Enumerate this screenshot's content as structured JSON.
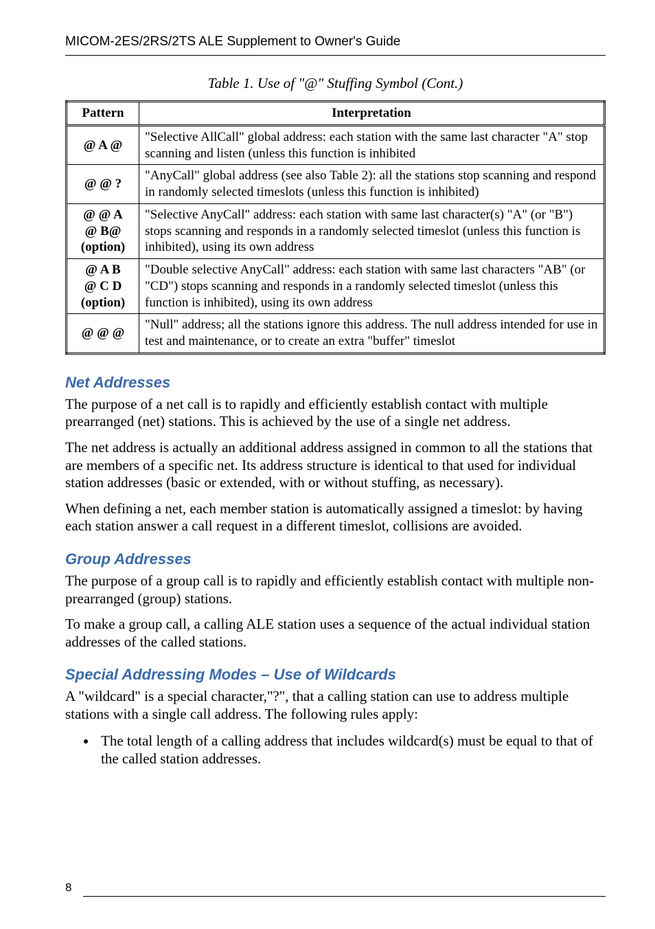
{
  "header": "MICOM-2ES/2RS/2TS ALE Supplement to Owner's Guide",
  "table_caption": "Table 1. Use of \"@\" Stuffing Symbol (Cont.)",
  "table": {
    "col1_header": "Pattern",
    "col2_header": "Interpretation",
    "rows": [
      {
        "pattern": "@ A @",
        "interp": "\"Selective AllCall\" global address: each station with the same last character \"A\" stop scanning and listen (unless this function is inhibited"
      },
      {
        "pattern": "@ @ ?",
        "interp": "\"AnyCall\" global address (see also Table 2): all the stations stop scanning and respond in randomly selected timeslots (unless this function is inhibited)"
      },
      {
        "pattern": "@ @ A\n@ B@\n(option)",
        "interp": "\"Selective AnyCall\" address: each station with same last character(s) \"A\" (or \"B\") stops scanning and responds in a randomly selected timeslot (unless this function is inhibited), using its own address"
      },
      {
        "pattern": "@ A B\n@ C D\n(option)",
        "interp": "\"Double selective AnyCall\" address: each station with same last characters \"AB\" (or \"CD\") stops scanning and responds in a randomly selected timeslot (unless this function is inhibited), using its own address"
      },
      {
        "pattern": "@ @ @",
        "interp": "\"Null\" address; all the stations ignore this address. The null address intended for use in test and maintenance, or to create an extra \"buffer\" timeslot"
      }
    ]
  },
  "sections": {
    "net_addresses": {
      "heading": "Net Addresses",
      "p1": "The purpose of a net call is to rapidly and efficiently establish contact with multiple prearranged (net) stations. This is achieved by the use of a single net address.",
      "p2": "The net address is actually an additional address assigned in common to all the stations that are members of a specific net. Its address structure is identical to that used for individual station addresses (basic or extended, with or without stuffing, as necessary).",
      "p3": "When defining a net, each member station is automatically assigned a timeslot: by having each station answer a call request in a different timeslot, collisions are avoided."
    },
    "group_addresses": {
      "heading": "Group Addresses",
      "p1": "The purpose of a group call is to rapidly and efficiently establish contact with multiple non-prearranged (group) stations.",
      "p2": "To make a group call, a calling ALE station uses a sequence of the actual individual station addresses of the called stations."
    },
    "special_modes": {
      "heading": "Special Addressing Modes – Use of Wildcards",
      "p1": "A \"wildcard\" is a special character,\"?\", that a calling station can use to address multiple stations with a single call address. The following rules apply:",
      "bullet1": "The total length of a calling address that includes wildcard(s) must be equal to that of the called station addresses."
    }
  },
  "page_number": "8"
}
